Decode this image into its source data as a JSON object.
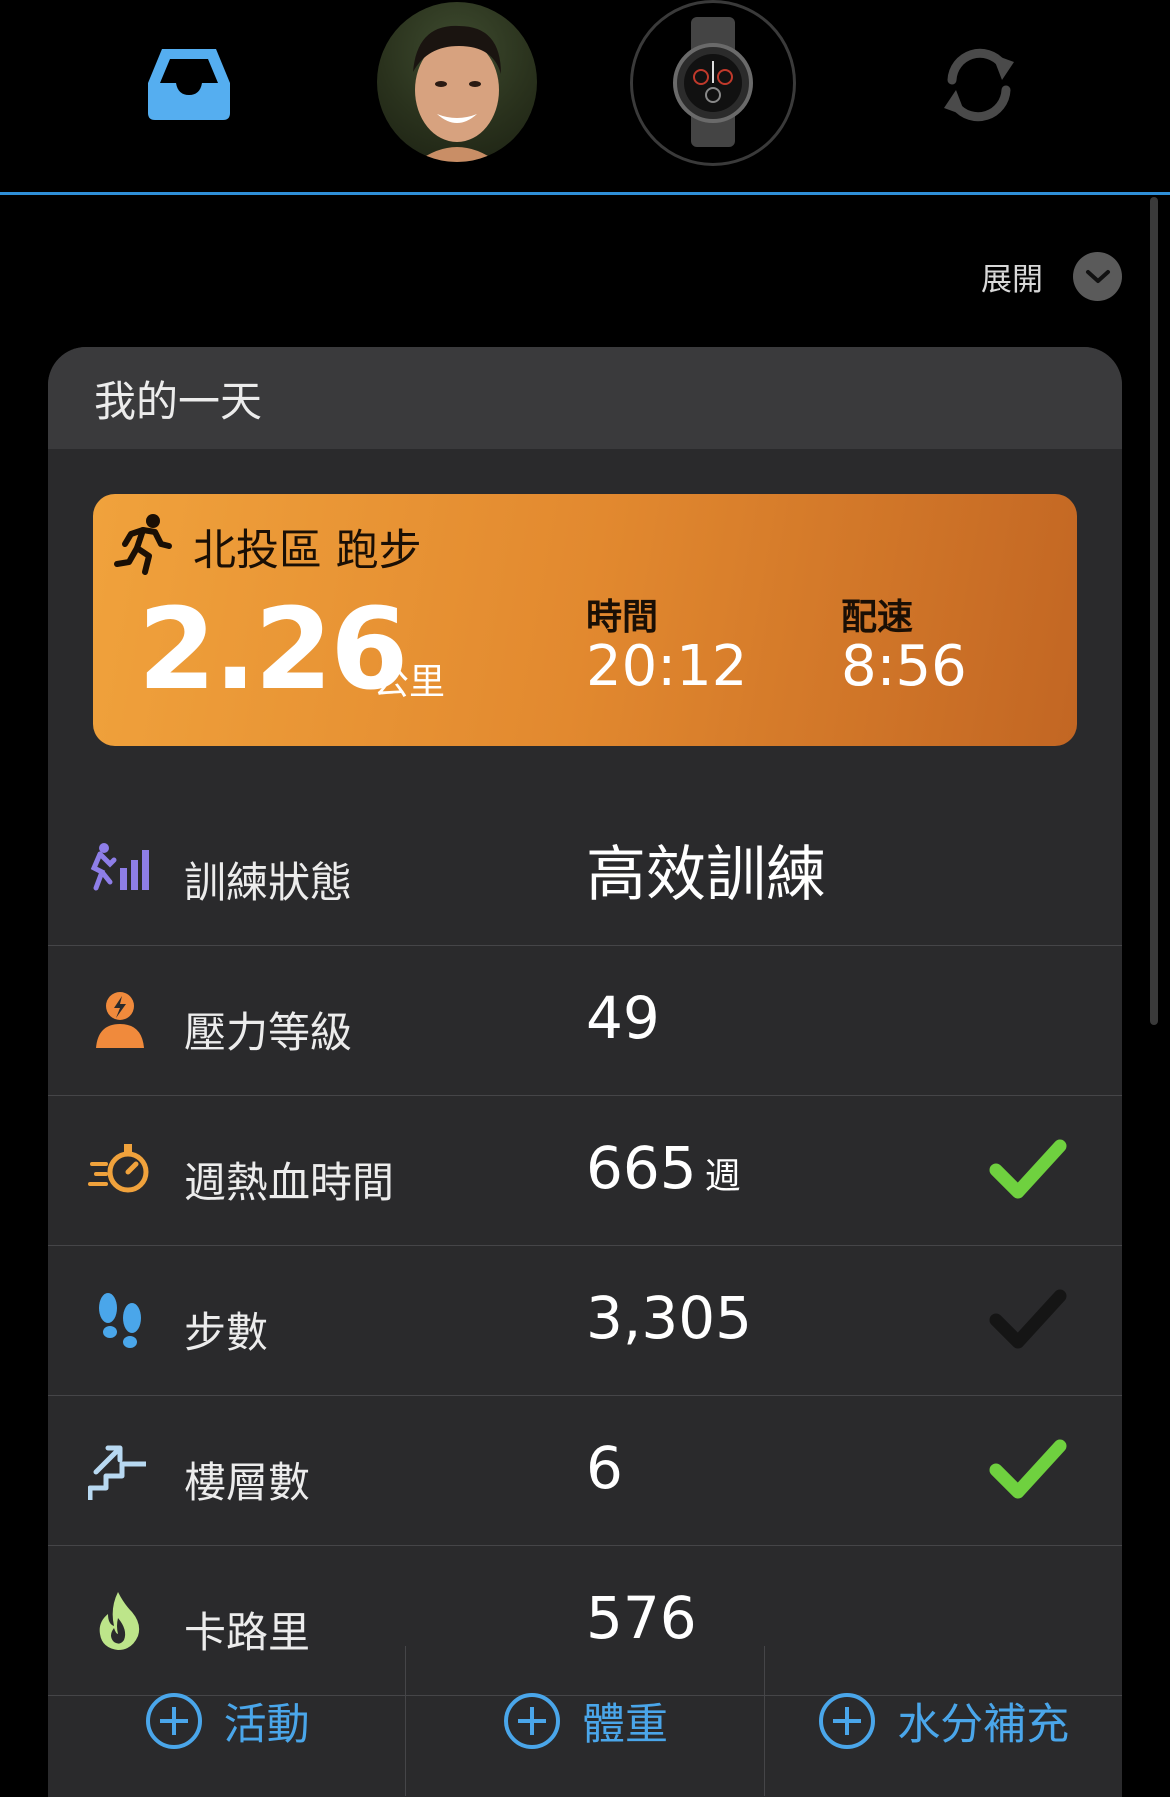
{
  "nav": {
    "icons": [
      "inbox-icon",
      "avatar",
      "watch-icon",
      "sync-icon"
    ],
    "accent": "#2f8fd8"
  },
  "expand": {
    "label": "展開"
  },
  "card": {
    "title": "我的一天",
    "activity": {
      "title": "北投區 跑步",
      "distance": "2.26",
      "distance_unit": "公里",
      "time_label": "時間",
      "time_value": "20:12",
      "pace_label": "配速",
      "pace_value": "8:56"
    },
    "stats": [
      {
        "label": "訓練狀態",
        "value": "高效訓練",
        "unit": "",
        "icon": "training-status-icon",
        "check": "none"
      },
      {
        "label": "壓力等級",
        "value": "49",
        "unit": "",
        "icon": "stress-icon",
        "check": "none"
      },
      {
        "label": "週熱血時間",
        "value": "665",
        "unit": "週",
        "icon": "intensity-minutes-icon",
        "check": "green"
      },
      {
        "label": "步數",
        "value": "3,305",
        "unit": "",
        "icon": "footsteps-icon",
        "check": "gray"
      },
      {
        "label": "樓層數",
        "value": "6",
        "unit": "",
        "icon": "stairs-icon",
        "check": "green"
      },
      {
        "label": "卡路里",
        "value": "576",
        "unit": "",
        "icon": "flame-icon",
        "check": "none"
      }
    ]
  },
  "actions": [
    {
      "label": "活動"
    },
    {
      "label": "體重"
    },
    {
      "label": "水分補充"
    }
  ]
}
